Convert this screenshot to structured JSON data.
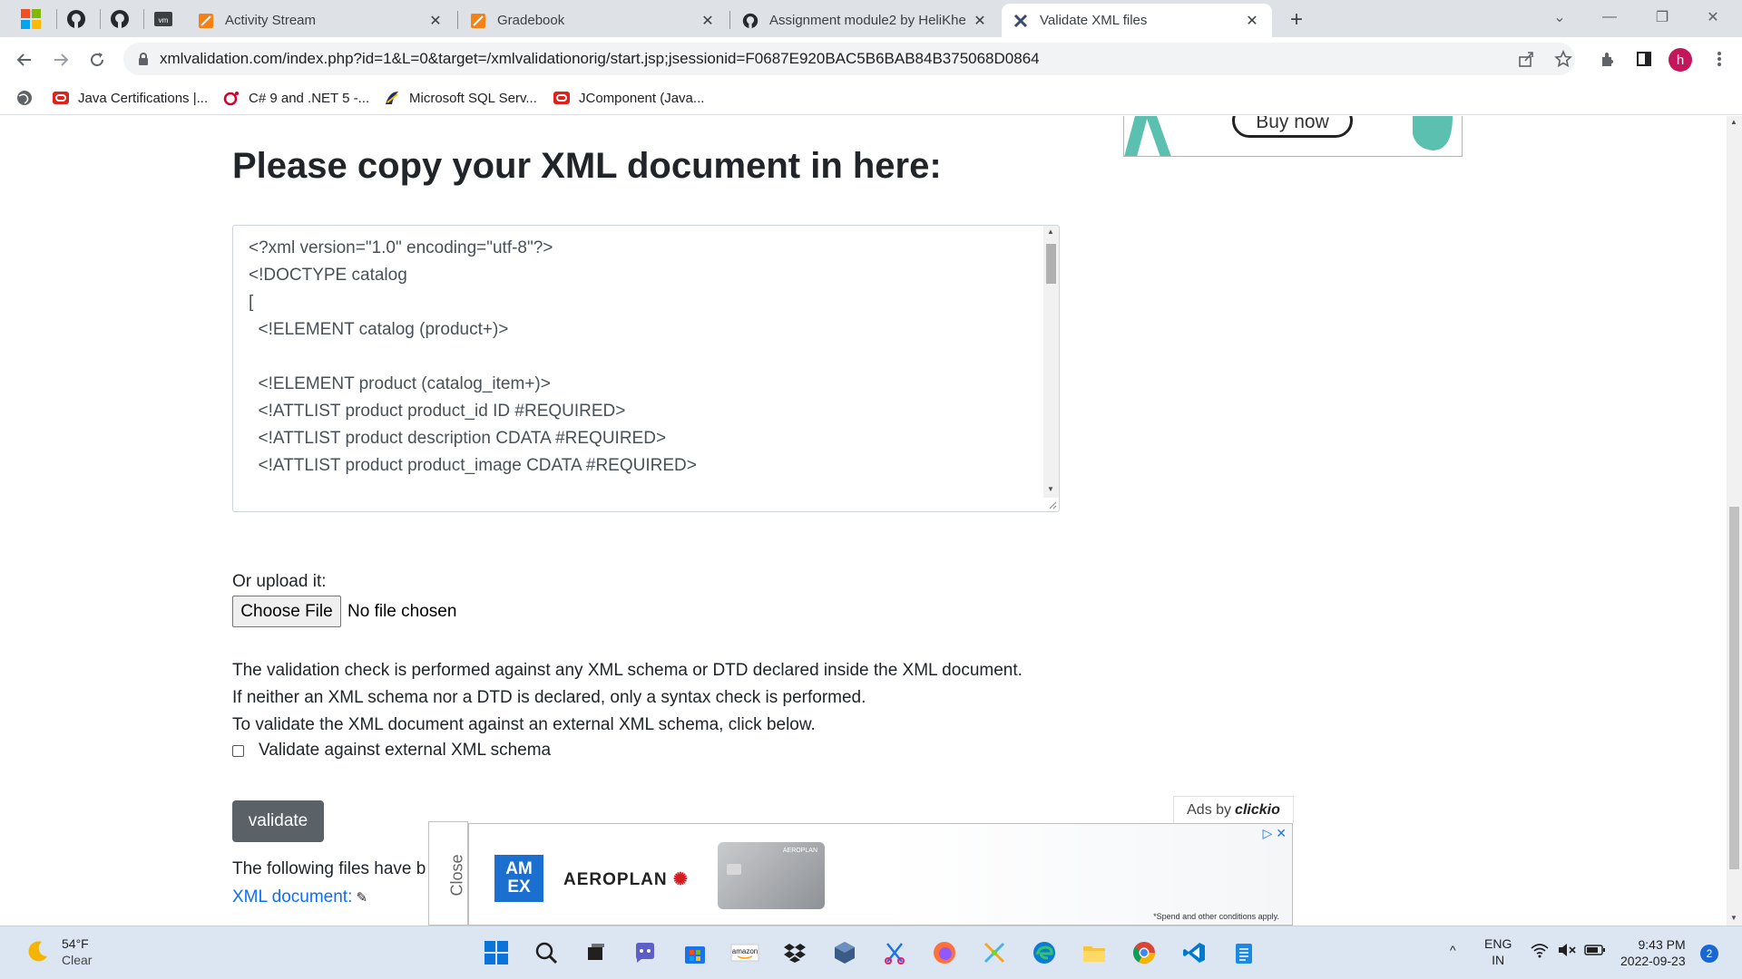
{
  "browser": {
    "tabs": [
      {
        "title": "Activity Stream",
        "icon": "moodle-icon"
      },
      {
        "title": "Gradebook",
        "icon": "moodle-icon"
      },
      {
        "title": "Assignment module2 by HeliKhe",
        "icon": "github-icon"
      },
      {
        "title": "Validate XML files",
        "icon": "xmlvalidation-icon",
        "active": true
      }
    ],
    "pinned_tabs": [
      "windows-icon",
      "github-icon",
      "github-icon",
      "vm-icon"
    ],
    "url": "xmlvalidation.com/index.php?id=1&L=0&target=/xmlvalidationorig/start.jsp;jsessionid=F0687E920BAC5B6BAB84B375068D0864",
    "profile_initial": "h",
    "bookmarks": [
      {
        "label": "Java Certifications |...",
        "icon": "oracle-icon"
      },
      {
        "label": "C# 9 and .NET 5 -...",
        "icon": "oreilly-icon"
      },
      {
        "label": "Microsoft SQL Serv...",
        "icon": "sql-icon"
      },
      {
        "label": "JComponent (Java...",
        "icon": "oracle-icon"
      }
    ]
  },
  "page": {
    "ad_top_button": "Buy now",
    "heading": "Please copy your XML document in here:",
    "xml_lines": [
      "<?xml version=\"1.0\" encoding=\"utf-8\"?>",
      "<!DOCTYPE catalog",
      "[",
      "  <!ELEMENT catalog (product+)>",
      "",
      "  <!ELEMENT product (catalog_item+)>",
      "  <!ATTLIST product product_id ID #REQUIRED>",
      "  <!ATTLIST product description CDATA #REQUIRED>",
      "  <!ATTLIST product product_image CDATA #REQUIRED>"
    ],
    "upload_label": "Or upload it:",
    "choose_file_label": "Choose File",
    "no_file_text": "No file chosen",
    "info_lines": [
      "The validation check is performed against any XML schema or DTD declared inside the XML document.",
      "If neither an XML schema nor a DTD is declared, only a syntax check is performed.",
      "To validate the XML document against an external XML schema, click below."
    ],
    "checkbox_label": "Validate against external XML schema",
    "checkbox_checked": false,
    "validate_label": "validate",
    "following_text": "The following files have b",
    "xml_link": "XML document:"
  },
  "ad_bottom": {
    "ads_by": "Ads by",
    "ads_brand": "clickio",
    "close_label": "Close",
    "amex_text": "AM EX",
    "brand": "AEROPLAN",
    "card_text": "AEROPLAN",
    "disclaimer": "*Spend and other conditions apply."
  },
  "taskbar": {
    "weather_temp": "54°F",
    "weather_desc": "Clear",
    "lang_top": "ENG",
    "lang_bottom": "IN",
    "time": "9:43 PM",
    "date": "2022-09-23",
    "notifications": "2",
    "apps": [
      "start-icon",
      "search-icon",
      "task-view-icon",
      "chat-icon",
      "store-icon",
      "amazon-icon",
      "dropbox-icon",
      "virtualbox-icon",
      "snipping-tool-icon",
      "firefox-icon",
      "xmind-icon",
      "edge-icon",
      "file-explorer-icon",
      "chrome-icon",
      "vscode-icon",
      "notepad-icon"
    ]
  },
  "colors": {
    "tabstrip": "#dee1e6",
    "validate_button": "#5a6268",
    "link": "#0d6efd",
    "taskbar": "#dce6f3"
  }
}
